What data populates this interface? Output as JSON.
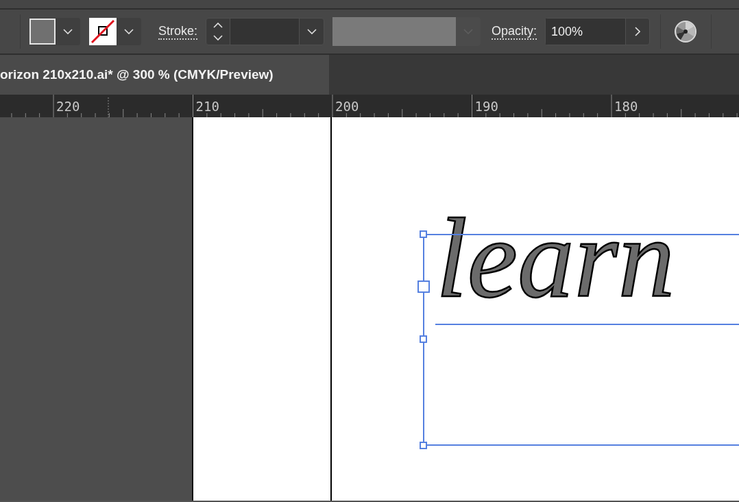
{
  "control_bar": {
    "stroke_label": "Stroke:",
    "profile_dropdown": {
      "disabled": true
    },
    "opacity_label": "Opacity:",
    "opacity_value": "100%"
  },
  "document_tab": {
    "title": "orizon 210x210.ai* @ 300 % (CMYK/Preview)",
    "selected": true
  },
  "ruler": {
    "labels": [
      "220",
      "210",
      "200",
      "190",
      "180"
    ]
  },
  "canvas": {
    "text": "learn",
    "selected": true
  }
}
